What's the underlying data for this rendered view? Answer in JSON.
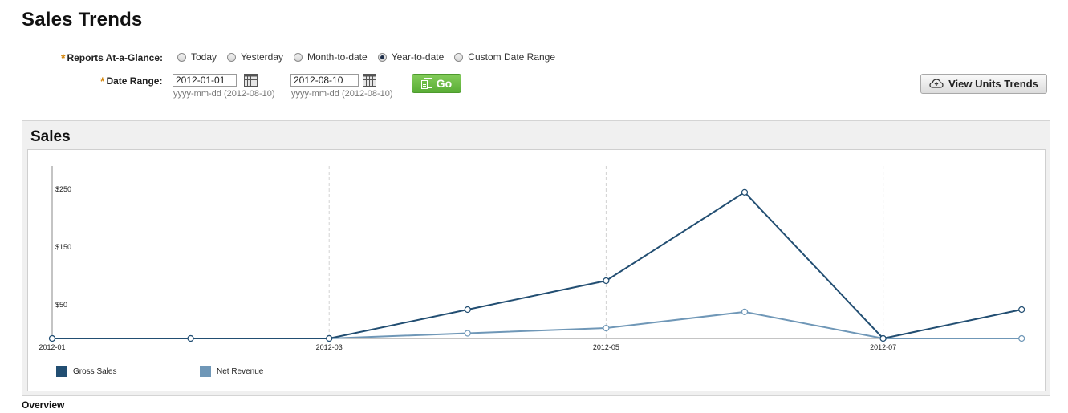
{
  "page": {
    "title": "Sales Trends"
  },
  "form": {
    "reports_label": "Reports At-a-Glance:",
    "required_marker": "*",
    "radio_options": [
      {
        "label": "Today",
        "checked": false
      },
      {
        "label": "Yesterday",
        "checked": false
      },
      {
        "label": "Month-to-date",
        "checked": false
      },
      {
        "label": "Year-to-date",
        "checked": true
      },
      {
        "label": "Custom Date Range",
        "checked": false
      }
    ],
    "date_range_label": "Date Range:",
    "start_date": "2012-01-01",
    "end_date": "2012-08-10",
    "start_hint": "yyyy-mm-dd (2012-08-10)",
    "end_hint": "yyyy-mm-dd (2012-08-10)",
    "go_label": "Go",
    "calendar_icon": "calendar-icon"
  },
  "toolbar": {
    "view_units_label": "View Units Trends",
    "view_units_icon": "cloud-arrow-icon"
  },
  "panel": {
    "title": "Sales"
  },
  "chart_data": {
    "type": "line",
    "title": "",
    "x_tick_labels": [
      "2012-01",
      "2012-03",
      "2012-05",
      "2012-07"
    ],
    "y_tick_labels": [
      "$250",
      "$150",
      "$50"
    ],
    "y_ticks": [
      250,
      150,
      50
    ],
    "ylim": [
      0,
      300
    ],
    "x_points": [
      "2012-01",
      "2012-02",
      "2012-03",
      "2012-04",
      "2012-05",
      "2012-06",
      "2012-07",
      "2012-08"
    ],
    "series": [
      {
        "name": "Gross Sales",
        "color": "#224e72",
        "values": [
          0,
          0,
          0,
          50,
          100,
          253,
          0,
          50
        ]
      },
      {
        "name": "Net Revenue",
        "color": "#6f97b7",
        "values": [
          0,
          0,
          0,
          9,
          18,
          46,
          0,
          0
        ]
      }
    ],
    "grid": {
      "vertical_dashed": true
    },
    "legend_position": "bottom-left"
  },
  "footer": {
    "overview_label": "Overview"
  }
}
